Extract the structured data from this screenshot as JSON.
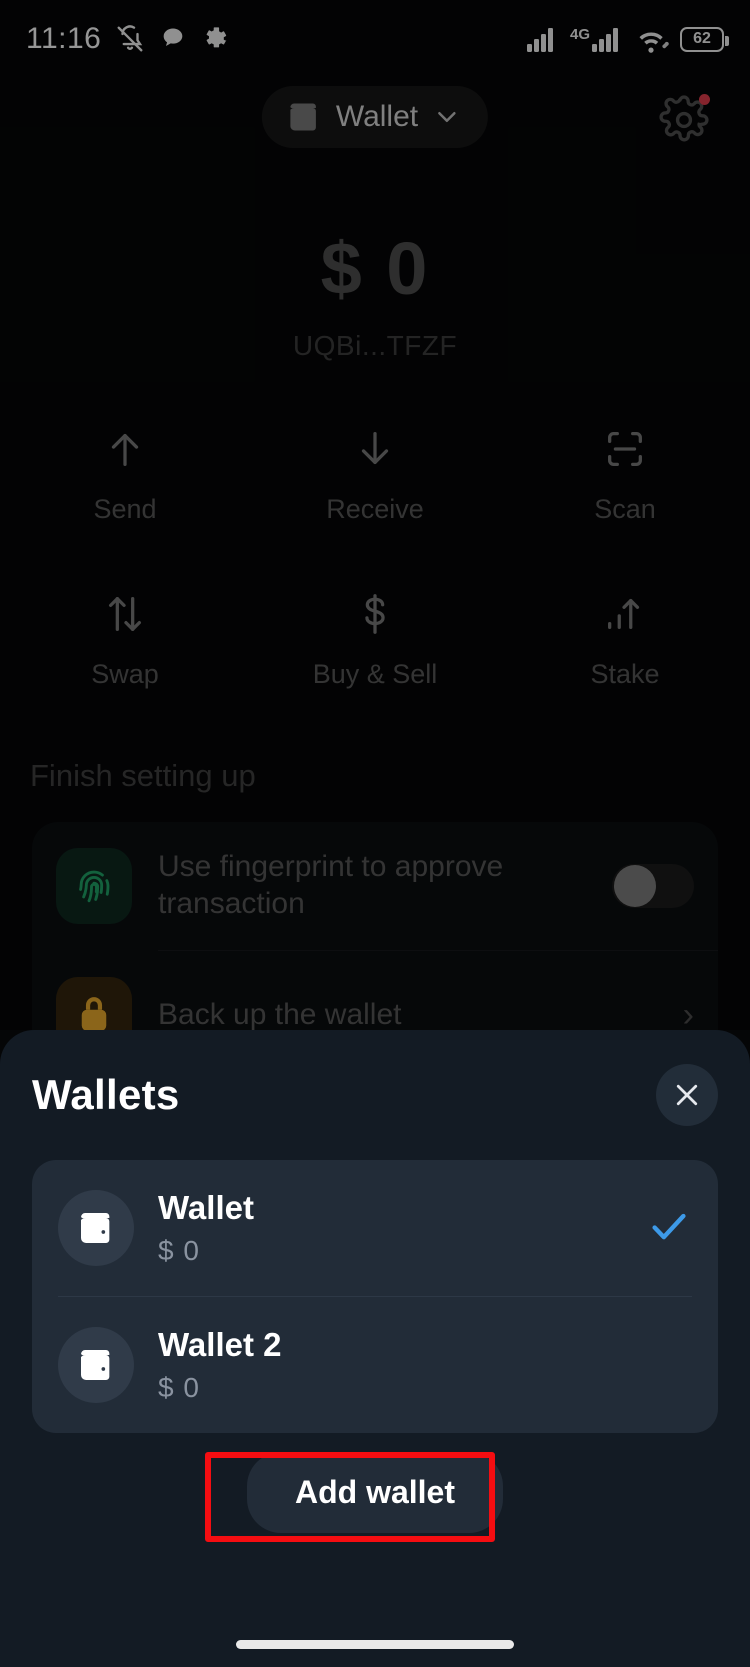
{
  "status_bar": {
    "time": "11:16",
    "icons_left": [
      "bell-muted-icon",
      "chat-bubble-icon",
      "settings-gear-icon"
    ],
    "network_label": "4G",
    "icons_right": [
      "signal-bars-icon",
      "signal-bars-4g-icon",
      "wifi-icon",
      "battery-icon"
    ],
    "battery_percent": "62"
  },
  "header": {
    "wallet_chip_label": "Wallet",
    "wallet_icon": "wallet-icon",
    "chevron_icon": "chevron-down-icon",
    "settings_icon": "gear-icon",
    "notification_dot_color": "#d83a4a"
  },
  "balance": {
    "amount": "$ 0",
    "address": "UQBi...TFZF"
  },
  "actions": [
    {
      "label": "Send",
      "icon": "arrow-up-icon"
    },
    {
      "label": "Receive",
      "icon": "arrow-down-icon"
    },
    {
      "label": "Scan",
      "icon": "scan-frame-icon"
    },
    {
      "label": "Swap",
      "icon": "swap-arrows-icon"
    },
    {
      "label": "Buy & Sell",
      "icon": "dollar-sign-icon"
    },
    {
      "label": "Stake",
      "icon": "chart-up-arrow-icon"
    }
  ],
  "setup": {
    "title": "Finish setting up",
    "rows": [
      {
        "text": "Use fingerprint to approve transaction",
        "icon": "fingerprint-icon",
        "icon_color": "#1f9d63",
        "control": "toggle",
        "toggle_on": false
      },
      {
        "text": "Back up the wallet",
        "icon": "lock-icon",
        "icon_color": "#e0a32a",
        "control": "chevron",
        "chevron_glyph": "›"
      }
    ]
  },
  "sheet": {
    "title": "Wallets",
    "close_icon": "close-icon",
    "wallets": [
      {
        "name": "Wallet",
        "balance": "$ 0",
        "icon": "wallet-icon",
        "selected": true,
        "check_icon": "check-icon"
      },
      {
        "name": "Wallet 2",
        "balance": "$ 0",
        "icon": "wallet-icon",
        "selected": false,
        "check_icon": "check-icon"
      }
    ],
    "add_wallet_label": "Add wallet",
    "accent_color": "#3d9ae8",
    "highlight_color": "#f50d11"
  }
}
